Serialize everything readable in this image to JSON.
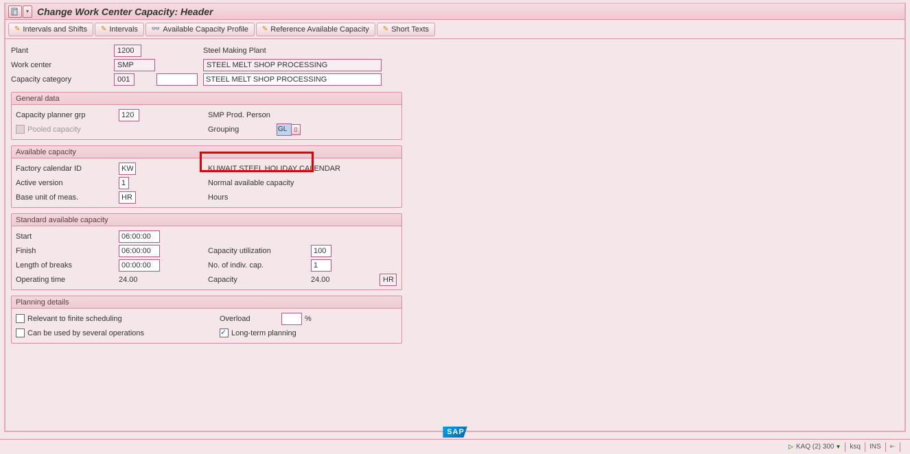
{
  "title": "Change Work Center Capacity: Header",
  "toolbar": {
    "intervals_shifts": "Intervals and Shifts",
    "intervals": "Intervals",
    "avail_profile": "Available Capacity Profile",
    "ref_avail": "Reference Available Capacity",
    "short_texts": "Short Texts"
  },
  "header": {
    "plant_lbl": "Plant",
    "plant_val": "1200",
    "plant_txt": "Steel Making Plant",
    "wc_lbl": "Work center",
    "wc_val": "SMP",
    "wc_txt": "STEEL MELT SHOP PROCESSING",
    "cc_lbl": "Capacity category",
    "cc_val": "001",
    "cc_txt": "STEEL MELT SHOP PROCESSING"
  },
  "general": {
    "title": "General data",
    "grp_lbl": "Capacity planner grp",
    "grp_val": "120",
    "grp_txt": "SMP Prod. Person",
    "pooled_lbl": "Pooled capacity",
    "grouping_lbl": "Grouping",
    "grouping_val": "GL"
  },
  "available": {
    "title": "Available capacity",
    "cal_lbl": "Factory calendar ID",
    "cal_val": "KW",
    "cal_txt": "KUWAIT STEEL HOLIDAY CALENDAR",
    "ver_lbl": "Active version",
    "ver_val": "1",
    "ver_txt": "Normal available capacity",
    "uom_lbl": "Base unit of meas.",
    "uom_val": "HR",
    "uom_txt": "Hours"
  },
  "standard": {
    "title": "Standard available capacity",
    "start_lbl": "Start",
    "start_val": "06:00:00",
    "finish_lbl": "Finish",
    "finish_val": "06:00:00",
    "util_lbl": "Capacity utilization",
    "util_val": "100",
    "breaks_lbl": "Length of breaks",
    "breaks_val": "00:00:00",
    "indiv_lbl": "No. of indiv. cap.",
    "indiv_val": "1",
    "optime_lbl": "Operating time",
    "optime_val": "24.00",
    "cap_lbl": "Capacity",
    "cap_val": "24.00",
    "cap_unit": "HR"
  },
  "planning": {
    "title": "Planning details",
    "finite_lbl": "Relevant to finite scheduling",
    "overload_lbl": "Overload",
    "overload_val": "",
    "overload_suffix": "%",
    "several_lbl": "Can be used by several operations",
    "longterm_lbl": "Long-term planning"
  },
  "status": {
    "system": "KAQ (2) 300",
    "user": "ksq",
    "mode": "INS"
  },
  "sap_logo": "SAP"
}
